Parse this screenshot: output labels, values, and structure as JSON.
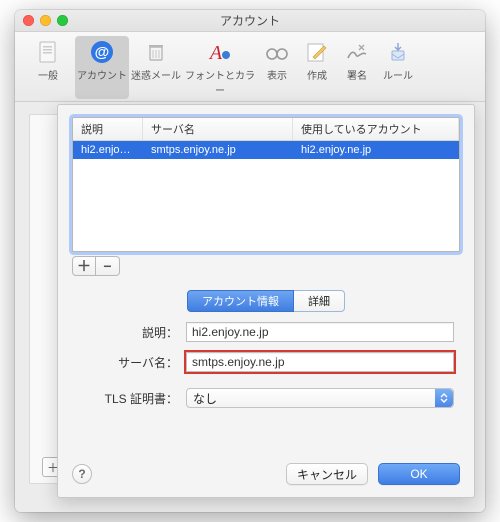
{
  "window": {
    "title": "アカウント"
  },
  "toolbar": {
    "items": [
      {
        "label": "一般"
      },
      {
        "label": "アカウント"
      },
      {
        "label": "迷惑メール"
      },
      {
        "label": "フォントとカラー"
      },
      {
        "label": "表示"
      },
      {
        "label": "作成"
      },
      {
        "label": "署名"
      },
      {
        "label": "ルール"
      }
    ],
    "active_index": 1
  },
  "sheet": {
    "table": {
      "headers": {
        "c1": "説明",
        "c2": "サーバ名",
        "c3": "使用しているアカウント"
      },
      "rows": [
        {
          "c1": "hi2.enjoy....",
          "c2": "smtps.enjoy.ne.jp",
          "c3": "hi2.enjoy.ne.jp",
          "selected": true
        }
      ]
    },
    "plus": "＋",
    "minus": "−",
    "seg": {
      "info": "アカウント情報",
      "detail": "詳細"
    },
    "form": {
      "desc_label": "説明：",
      "desc_value": "hi2.enjoy.ne.jp",
      "server_label": "サーバ名：",
      "server_value": "smtps.enjoy.ne.jp",
      "tls_label": "TLS 証明書：",
      "tls_value": "なし"
    },
    "help": "?",
    "cancel": "キャンセル",
    "ok": "OK"
  }
}
